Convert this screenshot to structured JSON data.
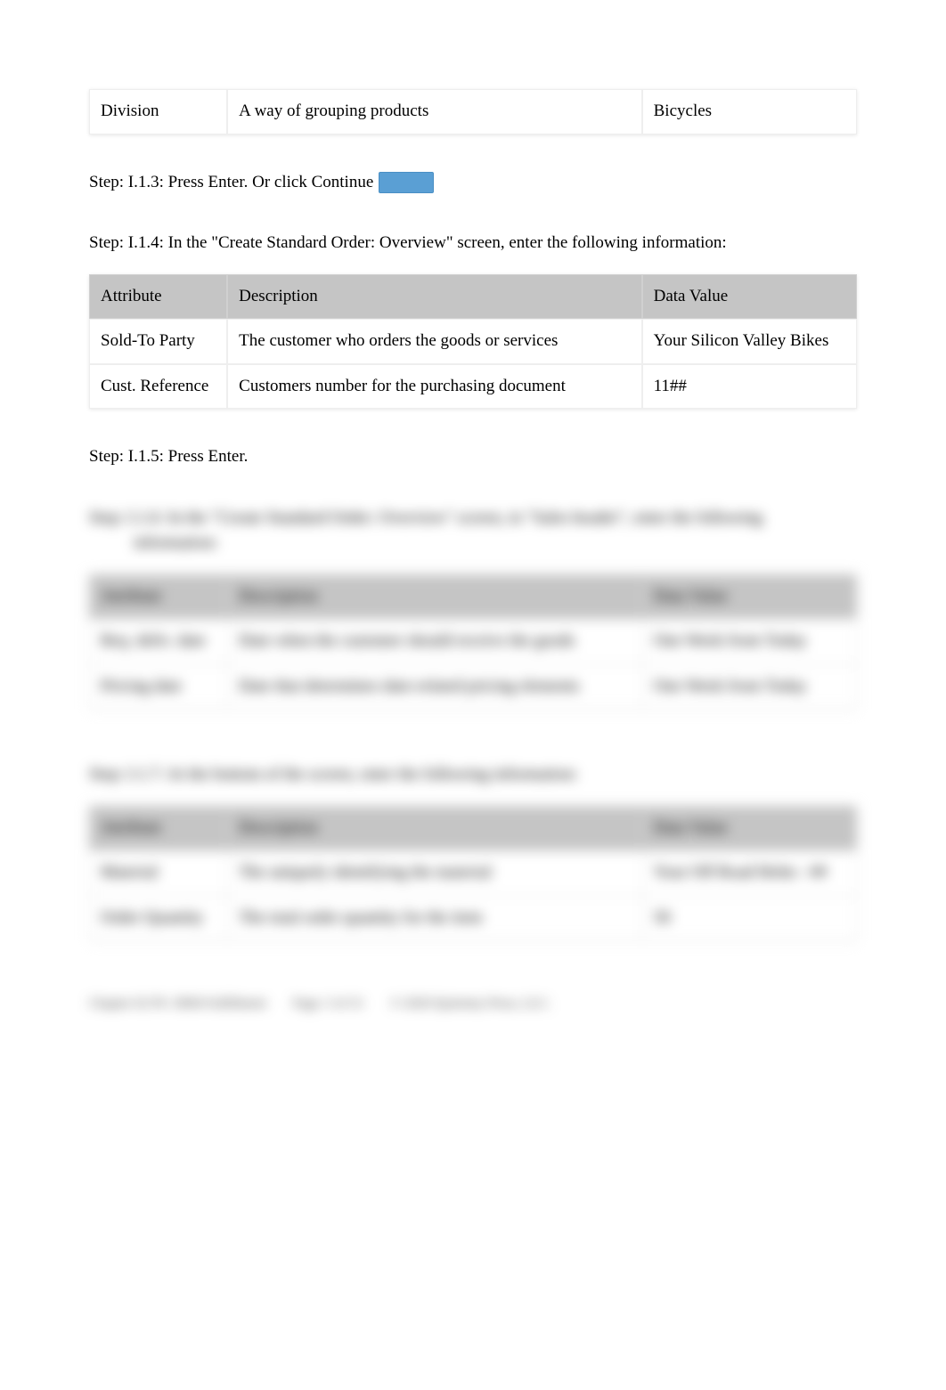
{
  "table0": {
    "rows": [
      {
        "attr": "Division",
        "desc": "A way of grouping products",
        "val": "Bicycles"
      }
    ]
  },
  "steps": {
    "s113_prefix": "Step: I.1.3: Press Enter. Or click Continue",
    "s114": "Step: I.1.4: In the \"Create Standard Order: Overview\" screen, enter the following information:",
    "s115": "Step: I.1.5: Press Enter.",
    "s116_l1": "Step: I.1.6: In the \"Create Standard Order: Overview\" screen, in \"Sales header\", enter the following",
    "s116_l2": "information:",
    "s117": "Step: I.1.7: At the bottom of the screen, enter the following information:"
  },
  "headers": {
    "attr": "Attribute",
    "desc": "Description",
    "val": "Data Value"
  },
  "table1": {
    "rows": [
      {
        "attr": "Sold-To Party",
        "desc": "The customer who orders the goods or services",
        "val": "Your Silicon Valley Bikes"
      },
      {
        "attr": "Cust. Reference",
        "desc": "Customers number for the purchasing document",
        "val": "11##"
      }
    ]
  },
  "table2": {
    "rows": [
      {
        "attr": "Req. deliv. date",
        "desc": "Date when the customer should receive the goods",
        "val": "One Week from Today"
      },
      {
        "attr": "Pricing date",
        "desc": "Date that determines date-related pricing elements",
        "val": "One Week from Today"
      }
    ]
  },
  "table3": {
    "rows": [
      {
        "attr": "Material",
        "desc": "The uniquely identifying the material",
        "val": "Your Off Road Helm - ##"
      },
      {
        "attr": "Order Quantity",
        "desc": "The total order quantity for the item",
        "val": "50"
      }
    ]
  },
  "footer": {
    "left": "Chapter 02 PS: SRM-Fulfillment",
    "mid": "Page: 3 of 31",
    "right": "© 2020 Epistemy Press, LLC."
  }
}
